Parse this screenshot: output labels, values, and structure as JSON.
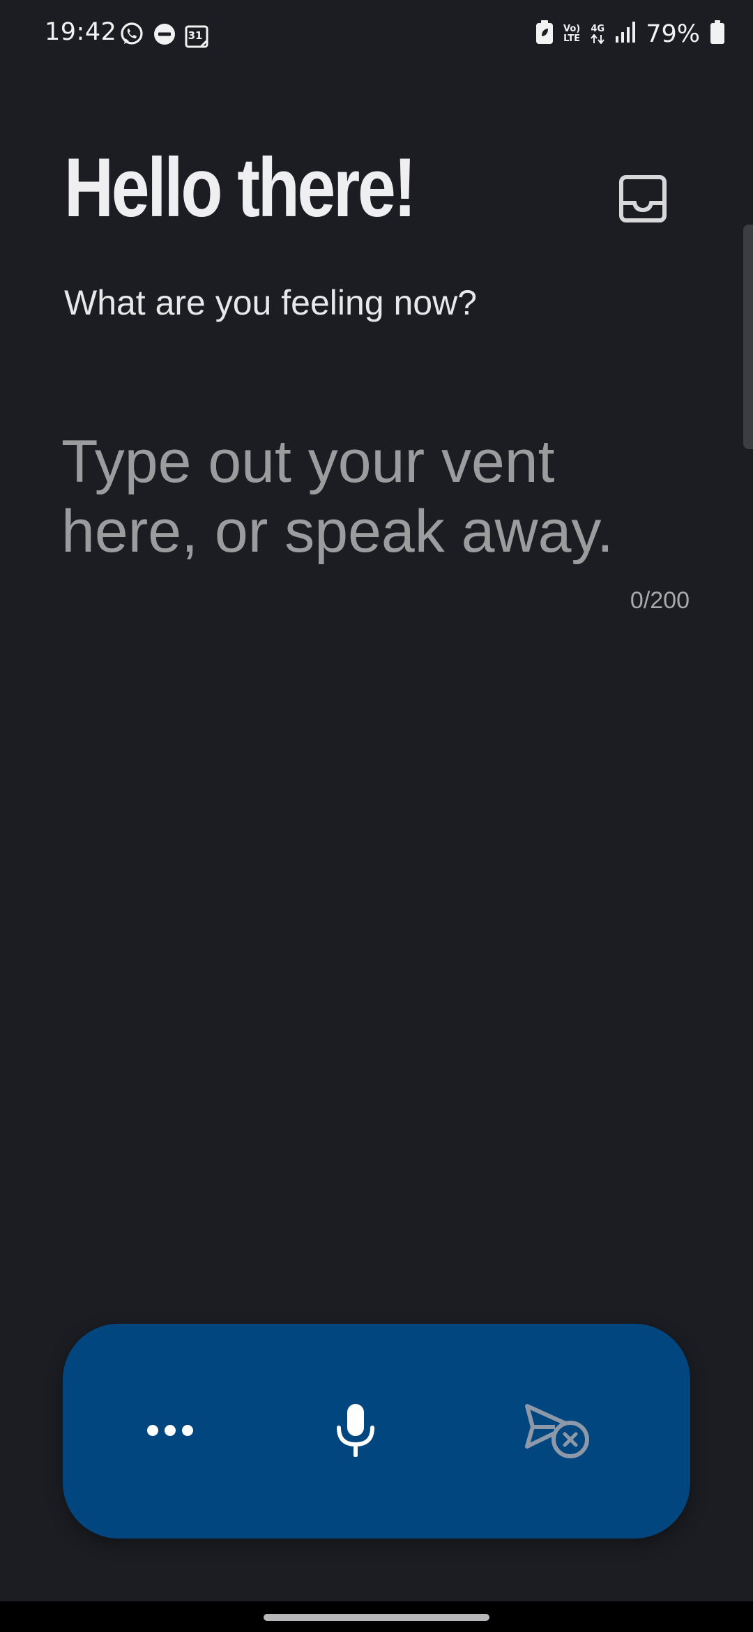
{
  "status_bar": {
    "time": "19:42",
    "battery_percent": "79%",
    "calendar_day": "31",
    "volte_label_top": "Vo)",
    "volte_label_bottom": "LTE",
    "network_label": "4G",
    "left_icons": [
      "whatsapp-icon",
      "do-not-disturb-icon",
      "calendar-icon"
    ],
    "right_icons": [
      "battery-saver-icon",
      "volte-icon",
      "network-4g-icon",
      "signal-icon",
      "battery-icon"
    ]
  },
  "header": {
    "title": "Hello there!",
    "subtitle": "What are you feeling now?",
    "inbox_icon": "inbox-tray-icon"
  },
  "vent": {
    "value": "",
    "placeholder": "Type out your vent here, or speak away.",
    "counter": "0/200"
  },
  "action_bar": {
    "buttons": [
      {
        "name": "more",
        "icon": "more-dots-icon",
        "enabled": true
      },
      {
        "name": "microphone",
        "icon": "microphone-icon",
        "enabled": true
      },
      {
        "name": "send-disabled",
        "icon": "send-cancel-icon",
        "enabled": false
      }
    ]
  },
  "colors": {
    "background": "#1b1d22",
    "action_bar": "#02467f",
    "text_primary": "#efeff1",
    "placeholder": "#9c9c9e",
    "icon_disabled": "#8d99a8"
  }
}
